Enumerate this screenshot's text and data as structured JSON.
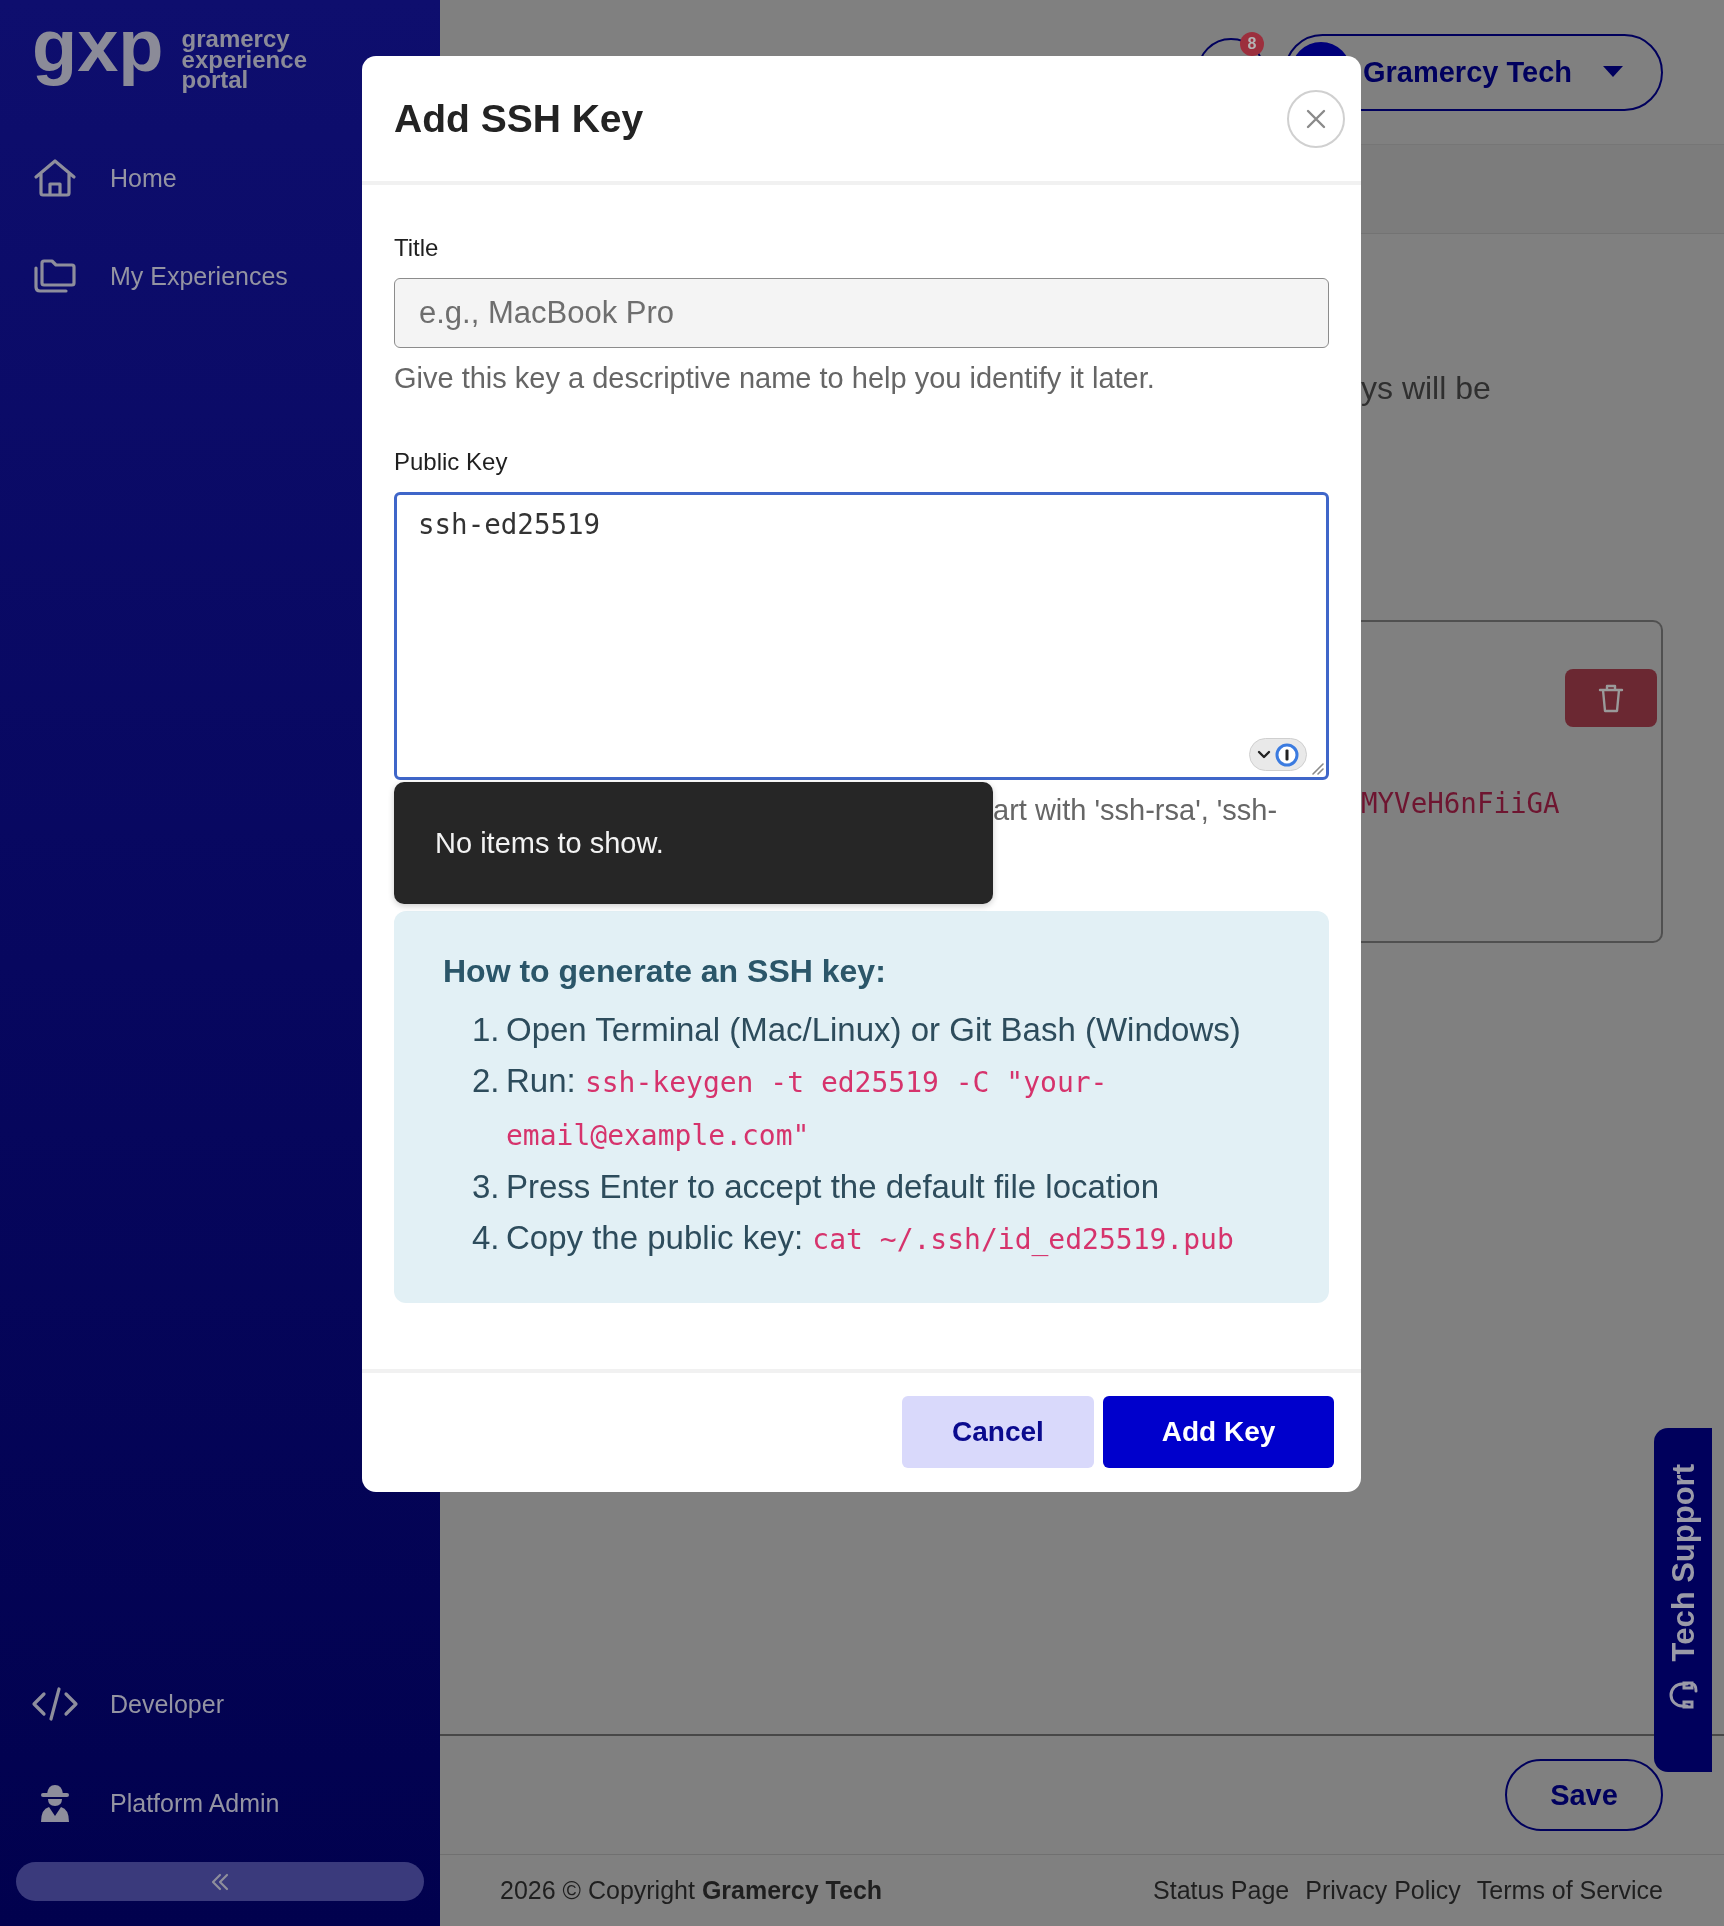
{
  "sidebar": {
    "logo": {
      "mark": "gxp",
      "wordmark": "gramercy experience portal"
    },
    "nav_top": [
      {
        "label": "Home"
      },
      {
        "label": "My Experiences"
      }
    ],
    "nav_bottom": [
      {
        "label": "Developer"
      },
      {
        "label": "Platform Admin"
      }
    ]
  },
  "header": {
    "notification_count": "8",
    "account": {
      "name": "Gramercy Tech"
    }
  },
  "page": {
    "intro_text": "ys will be",
    "key_card": {
      "key_text": "MYVeH6nFiiGA"
    },
    "save_button": "Save"
  },
  "footer": {
    "copyright": "2026 © Copyright **Gramercy Tech**",
    "links": [
      "Status Page",
      "Privacy Policy",
      "Terms of Service"
    ]
  },
  "support_tab": {
    "label": "Tech Support"
  },
  "modal": {
    "title": "Add SSH Key",
    "fields": [
      {
        "kind": "input",
        "label": "Title",
        "placeholder": "e.g., MacBook Pro",
        "hint": "Give this key a descriptive name to help you identify it later.",
        "focused": false
      },
      {
        "kind": "textarea",
        "label": "Public Key",
        "value": "ssh-ed25519",
        "hint": "art with 'ssh-rsa', 'ssh-",
        "focused": true
      }
    ],
    "autocomplete_popup": {
      "message": "No items to show."
    },
    "instructions": {
      "heading": "How to generate an SSH key:",
      "steps": [
        {
          "number": "1.",
          "text": "Open Terminal (Mac/Linux) or Git Bash (Windows)"
        },
        {
          "number": "2.",
          "text": "Run: ",
          "code": "ssh-keygen -t ed25519 -C \"your-email@example.com\""
        },
        {
          "number": "3.",
          "text": "Press Enter to accept the default file location"
        },
        {
          "number": "4.",
          "text": "Copy the public key: ",
          "code": "cat ~/.ssh/id_ed25519.pub"
        }
      ]
    },
    "buttons": [
      {
        "kind": "cancel",
        "label": "Cancel"
      },
      {
        "kind": "submit",
        "label": "Add Key"
      }
    ]
  }
}
